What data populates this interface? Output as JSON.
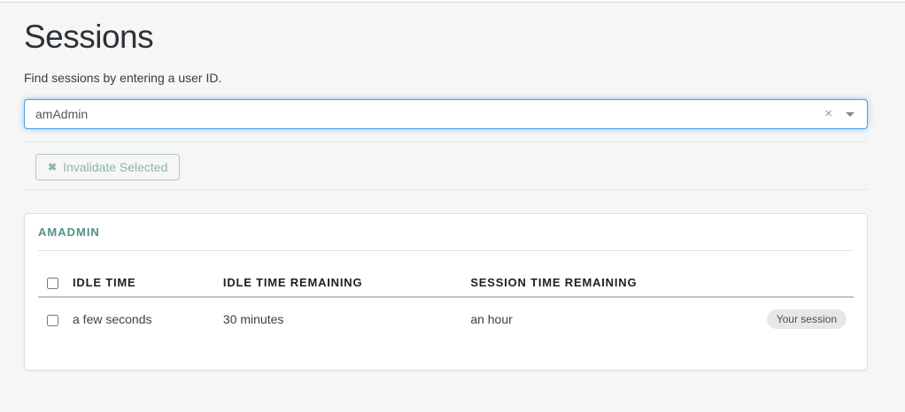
{
  "page": {
    "title": "Sessions",
    "subtitle": "Find sessions by entering a user ID."
  },
  "search": {
    "value": "amAdmin",
    "clear_icon": "×",
    "caret_icon": "dropdown-caret"
  },
  "toolbar": {
    "invalidate_icon": "✖",
    "invalidate_label": "Invalidate Selected"
  },
  "panel": {
    "heading": "AMADMIN",
    "table": {
      "columns": [
        "IDLE TIME",
        "IDLE TIME REMAINING",
        "SESSION TIME REMAINING"
      ],
      "rows": [
        {
          "checked": false,
          "idle_time": "a few seconds",
          "idle_time_remaining": "30 minutes",
          "session_time_remaining": "an hour",
          "badge": "Your session"
        }
      ]
    }
  },
  "colors": {
    "accent_teal": "#519387",
    "focus_blue": "#4a9fe8",
    "badge_bg": "#e7e7e7",
    "page_bg": "#f7f6f6"
  }
}
